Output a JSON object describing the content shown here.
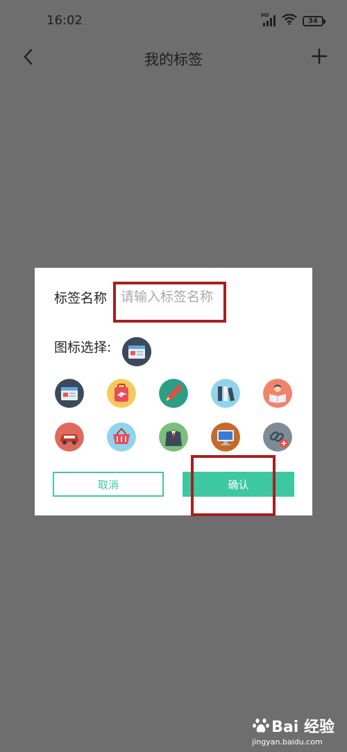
{
  "status_bar": {
    "time": "16:02",
    "network_label": "HD",
    "battery": "34"
  },
  "nav": {
    "title": "我的标签",
    "back_icon": "chevron-left-icon",
    "add_icon": "plus-icon"
  },
  "dialog": {
    "name_label": "标签名称",
    "name_placeholder": "请输入标签名称",
    "name_value": "",
    "icon_select_label": "图标选择:",
    "icons": [
      "calendar-icon",
      "luggage-icon",
      "pencil-icon",
      "binders-icon",
      "reading-person-icon",
      "car-icon",
      "shopping-basket-icon",
      "suit-icon",
      "monitor-icon",
      "link-add-icon"
    ],
    "cancel_label": "取消",
    "confirm_label": "确认"
  },
  "watermark": {
    "brand": "Bai 经验",
    "sub": "jingyan.baidu.com"
  },
  "colors": {
    "accent": "#3ec8a2",
    "annotation": "#a32121",
    "overlay": "#6e6e6e"
  }
}
